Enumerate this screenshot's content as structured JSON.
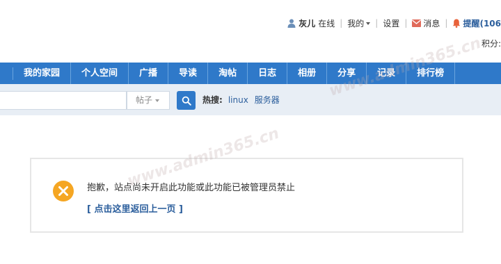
{
  "userbar": {
    "username": "灰儿",
    "status": "在线",
    "my_menu": "我的",
    "settings": "设置",
    "messages": "消息",
    "reminders": "提醒(106"
  },
  "points_label": "积分:",
  "nav": {
    "items": [
      "我的家园",
      "个人空间",
      "广播",
      "导读",
      "淘帖",
      "日志",
      "相册",
      "分享",
      "记录",
      "排行榜"
    ]
  },
  "search": {
    "type_label": "帖子",
    "hot_label": "热搜:",
    "hot_links": [
      "linux",
      "服务器"
    ]
  },
  "message": {
    "text": "抱歉，站点尚未开启此功能或此功能已被管理员禁止",
    "back_link": "[ 点击这里返回上一页 ]"
  },
  "watermarks": [
    "www.admin365.cn",
    "www.admin365.cn"
  ],
  "colors": {
    "nav_bg": "#2f79c9",
    "searchbar_bg": "#e8eef5",
    "link": "#2b5e9c",
    "error_icon": "#f5a623",
    "mail_icon": "#e06a5a",
    "bell_icon": "#e8623a"
  }
}
